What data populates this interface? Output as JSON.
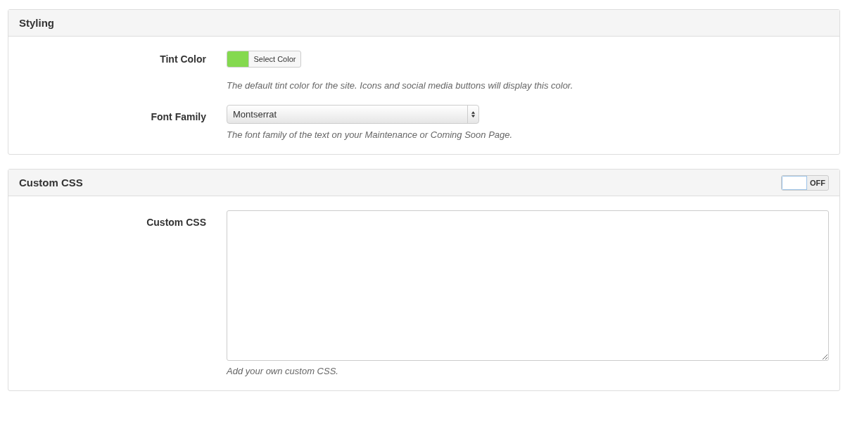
{
  "panels": [
    {
      "title": "Styling",
      "fields": [
        {
          "kind": "color",
          "label": "Tint Color",
          "color": "#84d94f",
          "button": "Select Color",
          "help": "The default tint color for the site. Icons and social media buttons will display this color."
        },
        {
          "kind": "select",
          "label": "Font Family",
          "value": "Montserrat",
          "help": "The font family of the text on your Maintenance or Coming Soon Page."
        }
      ]
    },
    {
      "title": "Custom CSS",
      "toggle": {
        "label": "OFF",
        "on": false
      },
      "fields": [
        {
          "kind": "textarea",
          "label": "Custom CSS",
          "help": "Add your own custom CSS."
        }
      ]
    }
  ]
}
